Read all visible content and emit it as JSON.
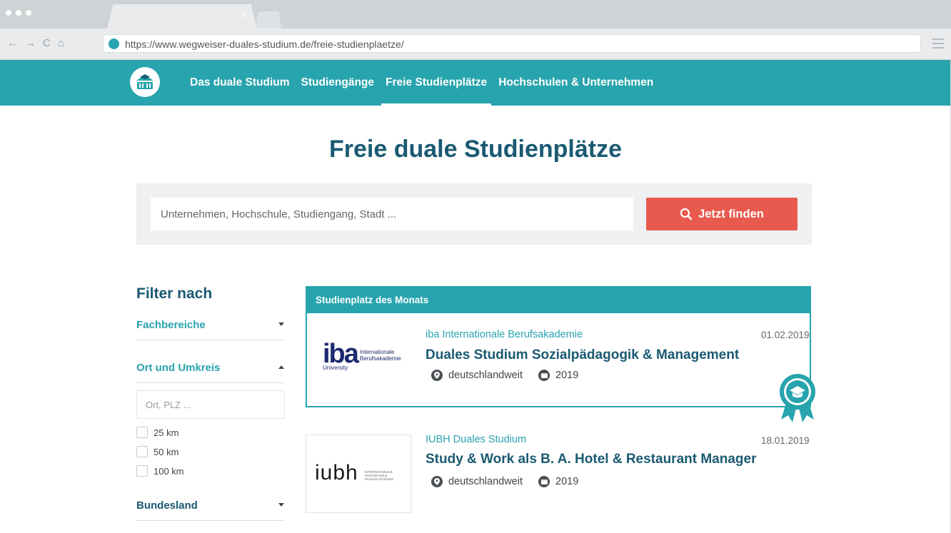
{
  "browser": {
    "tab_close": "×",
    "url": "https://www.wegweiser-duales-studium.de/freie-studienplaetze/",
    "nav_back": "←",
    "nav_forward": "→",
    "nav_reload": "C",
    "nav_home": "⌂"
  },
  "sitenav": {
    "items": [
      {
        "label": "Das duale Studium",
        "active": false
      },
      {
        "label": "Studiengänge",
        "active": false
      },
      {
        "label": "Freie Studienplätze",
        "active": true
      },
      {
        "label": "Hochschulen & Unternehmen",
        "active": false
      }
    ]
  },
  "page": {
    "title": "Freie duale Studienplätze"
  },
  "search": {
    "placeholder": "Unternehmen, Hochschule, Studiengang, Stadt ...",
    "button_label": "Jetzt finden"
  },
  "filter": {
    "title": "Filter nach",
    "sections": {
      "fachbereiche": "Fachbereiche",
      "ort": "Ort und Umkreis",
      "bundesland": "Bundesland"
    },
    "ort_placeholder": "Ort, PLZ ...",
    "radius_options": [
      "25 km",
      "50 km",
      "100 km"
    ]
  },
  "featured": {
    "header": "Studienplatz des Monats",
    "logo": {
      "main": "iba",
      "sub_line1": "Internationale",
      "sub_line2": "Berufsakademie",
      "university": "University"
    },
    "institution": "iba Internationale Berufsakademie",
    "title": "Duales Studium Sozialpädagogik & Management",
    "location": "deutschlandweit",
    "year": "2019",
    "date": "01.02.2019"
  },
  "listing2": {
    "logo": {
      "main": "iubh",
      "sub_line1": "INTERNATIONALE",
      "sub_line2": "HOCHSCHULE",
      "sub_line3": "DUALES STUDIUM"
    },
    "institution": "IUBH Duales Studium",
    "title": "Study & Work als B. A. Hotel & Restaurant Manager",
    "location": "deutschlandweit",
    "year": "2019",
    "date": "18.01.2019"
  },
  "colors": {
    "teal": "#27a4ad",
    "dark_blue": "#1a5a72",
    "cta_red": "#e75a4d"
  }
}
